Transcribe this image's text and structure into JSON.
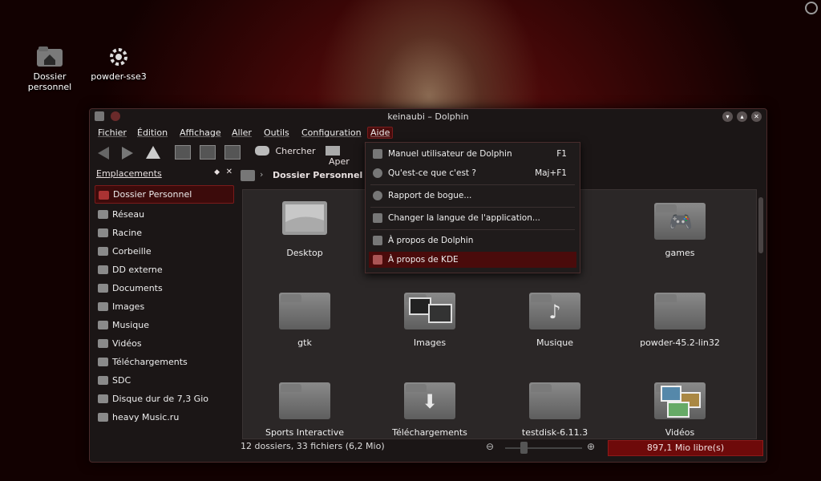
{
  "desktop": {
    "icons": [
      {
        "label": "Dossier personnel",
        "icon": "home-folder-icon"
      },
      {
        "label": "powder-sse3",
        "icon": "gear-icon"
      }
    ]
  },
  "window": {
    "title": "keinaubi – Dolphin"
  },
  "menubar": {
    "items": [
      "Fichier",
      "Édition",
      "Affichage",
      "Aller",
      "Outils",
      "Configuration",
      "Aide"
    ],
    "active": "Aide"
  },
  "toolbar": {
    "search_label": "Chercher",
    "preview_label": "Aper"
  },
  "sidebar": {
    "title": "Emplacements",
    "items": [
      {
        "label": "Dossier Personnel",
        "icon": "home-icon"
      },
      {
        "label": "Réseau",
        "icon": "network-icon"
      },
      {
        "label": "Racine",
        "icon": "drive-icon"
      },
      {
        "label": "Corbeille",
        "icon": "trash-icon"
      },
      {
        "label": "DD externe",
        "icon": "disk-icon"
      },
      {
        "label": "Documents",
        "icon": "documents-icon"
      },
      {
        "label": "Images",
        "icon": "images-icon"
      },
      {
        "label": "Musique",
        "icon": "music-icon"
      },
      {
        "label": "Vidéos",
        "icon": "videos-icon"
      },
      {
        "label": "Téléchargements",
        "icon": "download-icon"
      },
      {
        "label": "SDC",
        "icon": "sd-card-icon"
      },
      {
        "label": "Disque dur de 7,3 Gio",
        "icon": "harddisk-icon"
      },
      {
        "label": "heavy Music.ru",
        "icon": "disk-icon"
      }
    ]
  },
  "breadcrumb": {
    "current": "Dossier Personnel"
  },
  "files": [
    {
      "name": "Desktop",
      "icon": "desktop-icon"
    },
    {
      "name": "games",
      "icon": "gamepad-icon"
    },
    {
      "name": "gtk",
      "icon": "folder-icon"
    },
    {
      "name": "Images",
      "icon": "images-icon"
    },
    {
      "name": "Musique",
      "icon": "music-note-icon"
    },
    {
      "name": "powder-45.2-lin32",
      "icon": "folder-icon"
    },
    {
      "name": "Sports Interactive",
      "icon": "folder-icon"
    },
    {
      "name": "Téléchargements",
      "icon": "download-icon"
    },
    {
      "name": "testdisk-6.11.3",
      "icon": "folder-icon"
    },
    {
      "name": "Vidéos",
      "icon": "videos-icon"
    }
  ],
  "status": {
    "summary": "12 dossiers, 33 fichiers (6,2 Mio)",
    "free_space": "897,1 Mio libre(s)"
  },
  "help_menu": {
    "items": [
      {
        "label": "Manuel utilisateur de Dolphin",
        "shortcut": "F1"
      },
      {
        "label": "Qu'est-ce que c'est ?",
        "shortcut": "Maj+F1"
      },
      {
        "label": "Rapport de bogue...",
        "shortcut": ""
      },
      {
        "label": "Changer la langue de l'application...",
        "shortcut": ""
      },
      {
        "label": "À propos de Dolphin",
        "shortcut": ""
      },
      {
        "label": "À propos de KDE",
        "shortcut": ""
      }
    ]
  },
  "colors": {
    "accent": "#6e0a0a",
    "highlight": "#4a0b0b"
  }
}
